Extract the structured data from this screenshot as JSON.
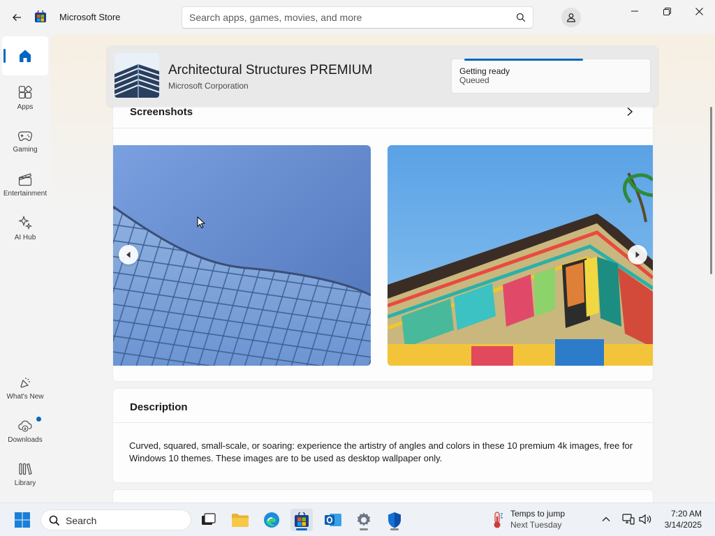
{
  "window": {
    "title": "Microsoft Store"
  },
  "search": {
    "placeholder": "Search apps, games, movies, and more"
  },
  "sidebar": {
    "items": [
      {
        "label": ""
      },
      {
        "label": "Apps"
      },
      {
        "label": "Gaming"
      },
      {
        "label": "Entertainment"
      },
      {
        "label": "AI Hub"
      },
      {
        "label": "What's New"
      },
      {
        "label": "Downloads"
      },
      {
        "label": "Library"
      }
    ]
  },
  "product": {
    "name": "Architectural Structures PREMIUM",
    "publisher": "Microsoft Corporation",
    "status": "Getting ready",
    "substatus": "Queued",
    "progress": 0.6
  },
  "screenshots": {
    "title": "Screenshots"
  },
  "description": {
    "title": "Description",
    "text": "Curved, squared, small-scale, or soaring: experience the artistry of angles and colors in these 10 premium 4k images, free for Windows 10 themes. These images are to be used as desktop wallpaper only."
  },
  "taskbar": {
    "search_label": "Search",
    "weather_line1": "Temps to jump",
    "weather_line2": "Next Tuesday",
    "time": "7:20 AM",
    "date": "3/14/2025"
  },
  "colors": {
    "accent": "#0067c0"
  }
}
